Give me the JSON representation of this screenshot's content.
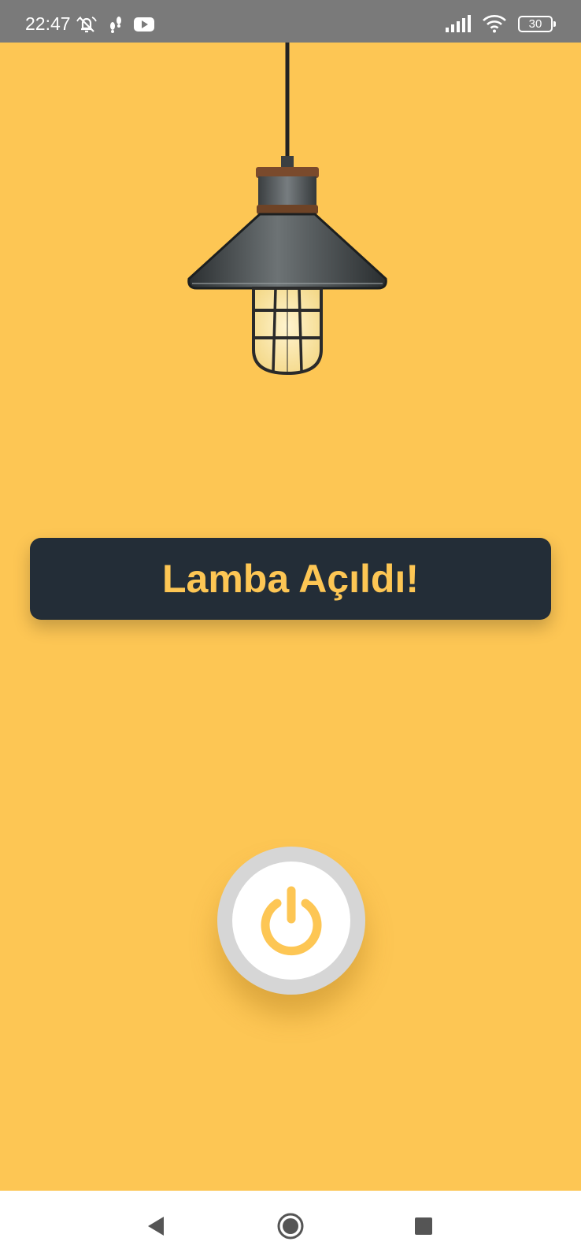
{
  "status_bar": {
    "time": "22:47",
    "battery_level": "30",
    "icons": [
      "muted-bell-icon",
      "footsteps-icon",
      "youtube-icon",
      "signal-icon",
      "wifi-icon",
      "battery-icon"
    ]
  },
  "lamp": {
    "icon": "hanging-lamp-icon",
    "state": "on"
  },
  "message": {
    "text": "Lamba Açıldı!"
  },
  "power_button": {
    "icon": "power-icon"
  },
  "nav_bar": {
    "icons": [
      "back-triangle-icon",
      "home-circle-icon",
      "recents-square-icon"
    ]
  },
  "colors": {
    "background": "#fdc654",
    "banner": "#232d37",
    "accent": "#fdc654",
    "status_bar": "#7a7a7a"
  }
}
